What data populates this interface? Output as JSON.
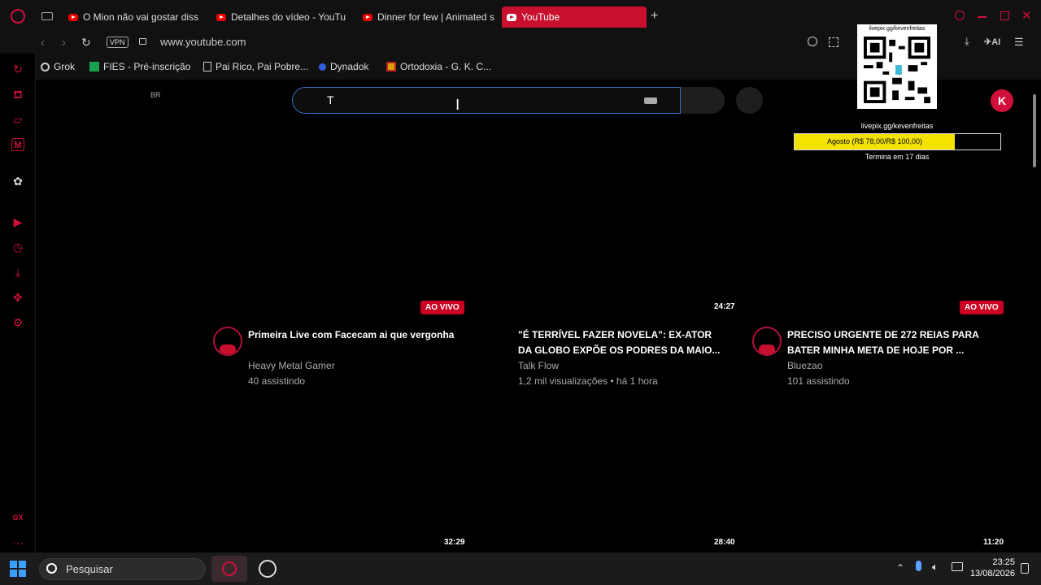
{
  "tabs": [
    {
      "title": "O Mion não vai gostar diss",
      "active": false
    },
    {
      "title": "Detalhes do vídeo - YouTu",
      "active": false
    },
    {
      "title": "Dinner for few | Animated s",
      "active": false
    },
    {
      "title": "YouTube",
      "active": true
    }
  ],
  "address": {
    "vpn_label": "VPN",
    "url": "www.youtube.com",
    "ai_label": "AI"
  },
  "bookmarks": [
    {
      "label": "Grok"
    },
    {
      "label": "FIES - Pré-inscrição"
    },
    {
      "label": "Pai Rico, Pai Pobre..."
    },
    {
      "label": "Dynadok"
    },
    {
      "label": "Ortodoxia - G. K. C..."
    }
  ],
  "youtube": {
    "region": "BR",
    "search_value": "T",
    "avatar_letter": "K"
  },
  "overlay": {
    "qr_caption": "livepix.gg/kevenfreitas",
    "goal_url": "livepix.gg/kevenfreitas",
    "goal_text": "Agosto (R$ 78,00/R$ 100,00)",
    "goal_progress": 0.78,
    "goal_ends": "Termina em 17 dias"
  },
  "videos": [
    {
      "badge": "AO VIVO",
      "title": "Primeira Live com Facecam ai que vergonha",
      "channel": "Heavy Metal Gamer",
      "meta": "40 assistindo"
    },
    {
      "duration": "24:27",
      "title": "\"É TERRÍVEL FAZER NOVELA\": EX-ATOR DA GLOBO EXPÕE OS PODRES DA MAIO...",
      "channel": "Talk Flow",
      "meta": "1,2 mil visualizações • há 1 hora"
    },
    {
      "badge": "AO VIVO",
      "title": "PRECISO URGENTE DE 272 REIAS PARA BATER MINHA META DE HOJE POR ...",
      "channel": "Bluezao",
      "meta": "101 assistindo"
    }
  ],
  "next_row_durations": [
    "32:29",
    "28:40",
    "11:20"
  ],
  "sidebar": {
    "gx_label": "GX"
  },
  "taskbar": {
    "search_label": "Pesquisar",
    "time": "23:25",
    "date": "13/08/2026"
  },
  "colors": {
    "accent": "#c8102e",
    "goal_fill": "#f4e200",
    "live_badge": "#cc0022"
  }
}
